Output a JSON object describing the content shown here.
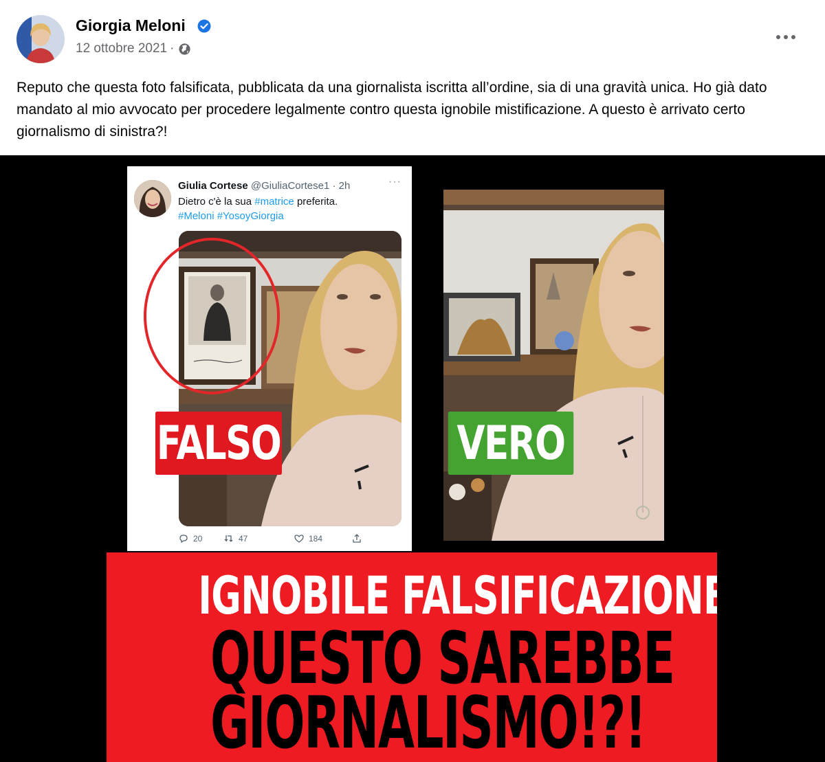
{
  "post": {
    "author": "Giorgia Meloni",
    "date": "12 ottobre 2021",
    "separator": "·",
    "privacy_icon": "globe-icon",
    "verified_icon": "verified-badge-icon",
    "more_icon": "more-options-icon",
    "text": "Reputo che questa foto falsificata, pubblicata da una giornalista iscritta all’ordine, sia di una gravità unica. Ho già dato mandato al mio avvocato per procedere legalmente contro questa ignobile mistificazione. A questo è arrivato certo giornalismo di sinistra?!"
  },
  "image": {
    "tweet": {
      "name": "Giulia Cortese",
      "handle": "@GiuliaCortese1 · 2h",
      "line1_prefix": "Dietro c'è la sua ",
      "line1_tag": "#matrice",
      "line1_suffix": " preferita.",
      "line2": "#Meloni #YosoyGiorgia",
      "replies": "20",
      "retweets": "47",
      "likes": "184"
    },
    "label_false": "FALSO",
    "label_true": "VERO",
    "banner": {
      "line1": "IGNOBILE FALSIFICAZIONE",
      "line2": "QUESTO SAREBBE",
      "line3": "GIORNALISMO!?!"
    },
    "colors": {
      "false_red": "#e0181f",
      "true_green": "#45a331",
      "banner_red": "#ee1c22",
      "circle_red": "#e3262a"
    }
  }
}
